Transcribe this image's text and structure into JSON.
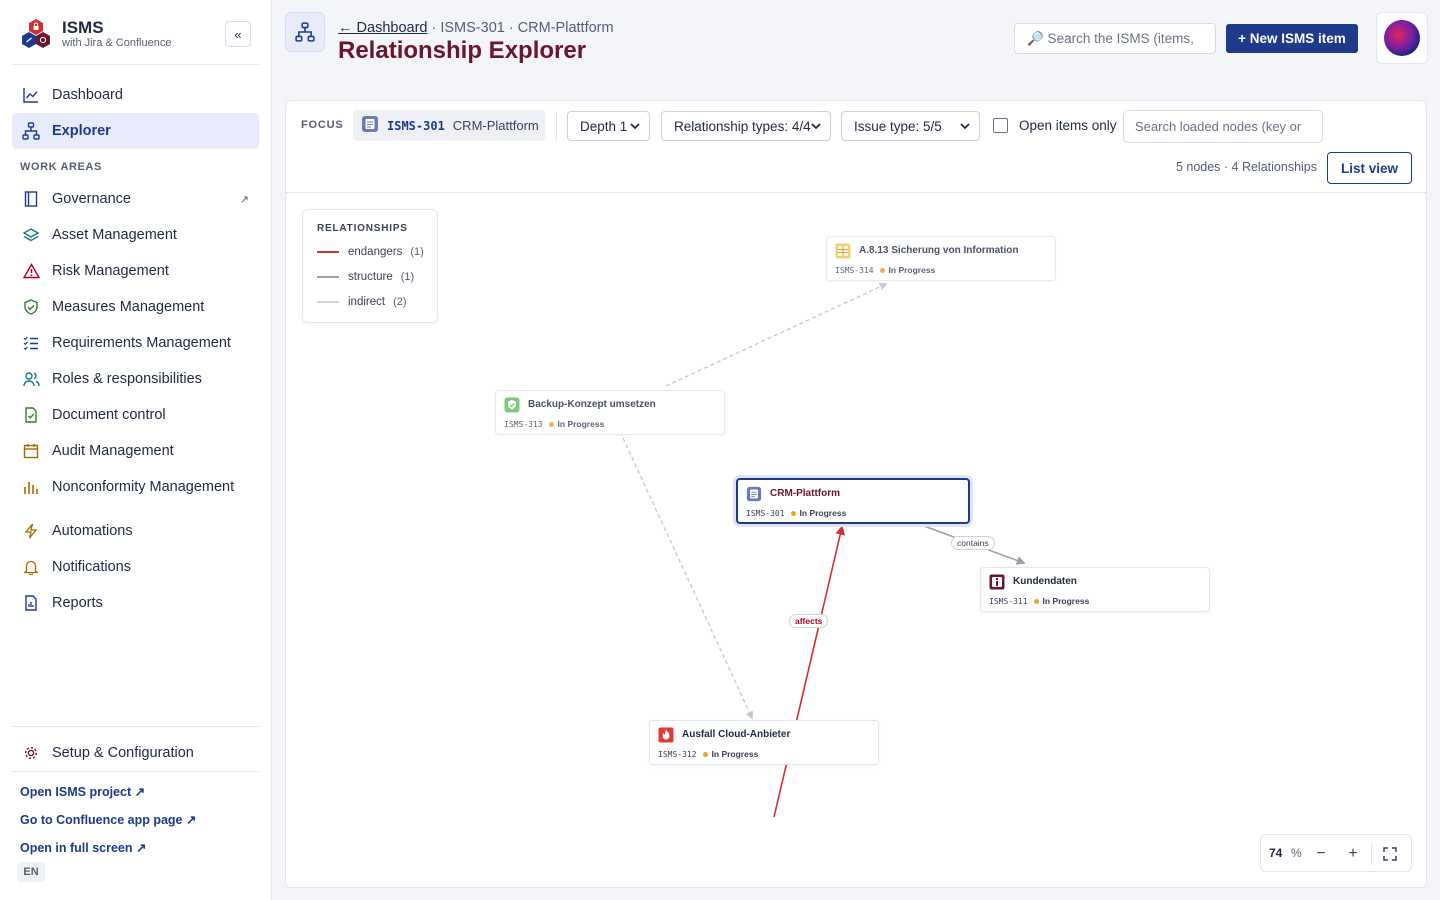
{
  "brand": {
    "name": "ISMS",
    "subtitle": "with Jira & Confluence",
    "collapse_label": "«"
  },
  "nav": {
    "primary": [
      {
        "label": "Dashboard",
        "icon": "line-chart-icon"
      },
      {
        "label": "Explorer",
        "icon": "hierarchy-icon",
        "active": true
      }
    ],
    "section_label": "WORK AREAS",
    "work_areas": [
      {
        "label": "Governance",
        "icon": "book-icon",
        "external": "↗"
      },
      {
        "label": "Asset Management",
        "icon": "layers-icon"
      },
      {
        "label": "Risk Management",
        "icon": "warning-icon"
      },
      {
        "label": "Measures Management",
        "icon": "shield-check-icon"
      },
      {
        "label": "Requirements Management",
        "icon": "checklist-icon"
      },
      {
        "label": "Roles & responsibilities",
        "icon": "users-icon"
      },
      {
        "label": "Document control",
        "icon": "document-check-icon"
      },
      {
        "label": "Audit Management",
        "icon": "calendar-icon"
      },
      {
        "label": "Nonconformity Management",
        "icon": "bar-chart-icon"
      }
    ],
    "extras": [
      {
        "label": "Automations",
        "icon": "lightning-icon"
      },
      {
        "label": "Notifications",
        "icon": "bell-icon"
      },
      {
        "label": "Reports",
        "icon": "report-icon"
      }
    ],
    "setup": {
      "label": "Setup & Configuration",
      "icon": "gear-icon"
    },
    "links": [
      "Open ISMS project ↗",
      "Go to Confluence app page ↗",
      "Open in full screen ↗"
    ],
    "language": "EN"
  },
  "header": {
    "breadcrumb_back": "← Dashboard",
    "breadcrumb_rest": " · ISMS-301 · CRM-Plattform",
    "title": "Relationship Explorer",
    "search_placeholder": "🔎 Search the ISMS (items,",
    "new_button": "+ New ISMS item"
  },
  "toolbar": {
    "focus_label": "FOCUS",
    "focus_key": "ISMS-301",
    "focus_name": "CRM-Plattform",
    "depth": "Depth 1",
    "relationship_types": "Relationship types: 4/4",
    "issue_type": "Issue type: 5/5",
    "open_only_label": "Open items only",
    "search_nodes_placeholder": "Search loaded nodes (key or",
    "counts": "5 nodes · 4 Relationships",
    "list_view": "List view"
  },
  "legend": {
    "title": "RELATIONSHIPS",
    "items": [
      {
        "label": "endangers",
        "count": "(1)",
        "color": "#d32f2f"
      },
      {
        "label": "structure",
        "count": "(1)",
        "color": "#9aa0ac"
      },
      {
        "label": "indirect",
        "count": "(2)",
        "color": "#cfd3da"
      }
    ]
  },
  "nodes": [
    {
      "id": "n314",
      "title": "A.8.13 Sicherung von Information",
      "key": "ISMS-314",
      "status": "In Progress",
      "icon": "control-icon"
    },
    {
      "id": "n313",
      "title": "Backup-Konzept umsetzen",
      "key": "ISMS-313",
      "status": "In Progress",
      "icon": "measure-icon"
    },
    {
      "id": "n301",
      "title": "CRM-Plattform",
      "key": "ISMS-301",
      "status": "In Progress",
      "icon": "asset-icon"
    },
    {
      "id": "n311",
      "title": "Kundendaten",
      "key": "ISMS-311",
      "status": "In Progress",
      "icon": "information-icon"
    },
    {
      "id": "n312",
      "title": "Ausfall Cloud-Anbieter",
      "key": "ISMS-312",
      "status": "In Progress",
      "icon": "risk-icon"
    }
  ],
  "edge_labels": {
    "contains": "contains",
    "affects": "affects"
  },
  "zoom": {
    "value": "74",
    "unit": "%",
    "minus": "−",
    "plus": "+"
  },
  "colors": {
    "accent": "#1e3a8a",
    "title": "#6b1530",
    "endangers": "#d32f2f",
    "status_dot": "#f0a030"
  }
}
